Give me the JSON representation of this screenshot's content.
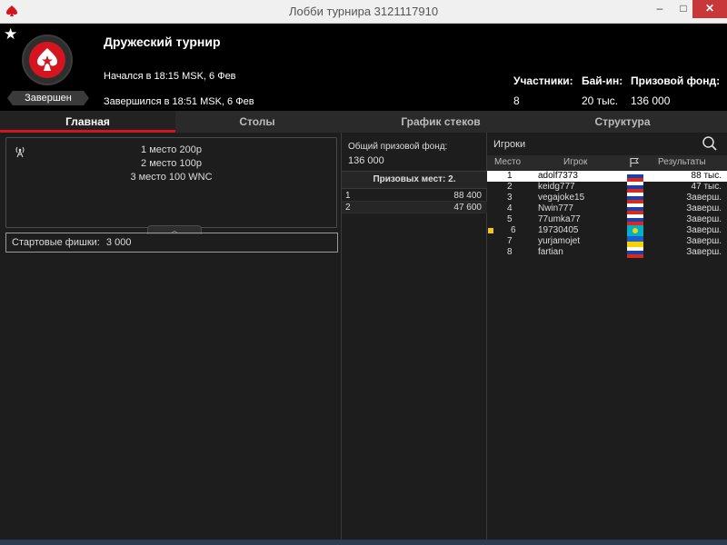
{
  "window": {
    "title": "Лобби турнира 3121117910",
    "min": "–",
    "max": "□",
    "close": "✕"
  },
  "header": {
    "tournament_name": "Дружеский турнир",
    "status": "Завершен",
    "started": "Начался в 18:15 MSK, 6 Фев",
    "ended": "Завершился в 18:51 MSK, 6 Фев",
    "stats": [
      {
        "label": "Участники:",
        "value": "8"
      },
      {
        "label": "Бай-ин:",
        "value": "20 тыс."
      },
      {
        "label": "Призовой фонд:",
        "value": "136 000"
      }
    ]
  },
  "tabs": [
    {
      "label": "Главная",
      "active": true
    },
    {
      "label": "Столы"
    },
    {
      "label": "График стеков"
    },
    {
      "label": "Структура"
    }
  ],
  "main": {
    "prize_lines": [
      "1 место 200р",
      "2 место 100р",
      "3 место 100 WNC"
    ],
    "starting_chips_label": "Стартовые фишки:",
    "starting_chips_value": "3 000"
  },
  "prize_pool": {
    "label": "Общий призовой фонд:",
    "value": "136 000",
    "paid_places_header": "Призовых мест: 2.",
    "payouts": [
      {
        "place": "1",
        "amount": "88 400"
      },
      {
        "place": "2",
        "amount": "47 600"
      }
    ]
  },
  "players": {
    "title": "Игроки",
    "columns": {
      "place": "Место",
      "player": "Игрок",
      "results": "Результаты"
    },
    "rows": [
      {
        "place": "1",
        "name": "adolf7373",
        "flag": "ru",
        "result": "88 тыс.",
        "selected": true
      },
      {
        "place": "2",
        "name": "keidg777",
        "flag": "ru",
        "result": "47 тыс."
      },
      {
        "place": "3",
        "name": "vegajoke15",
        "flag": "ru",
        "result": "Заверш."
      },
      {
        "place": "4",
        "name": "Nwin777",
        "flag": "ru",
        "result": "Заверш."
      },
      {
        "place": "5",
        "name": "77umka77",
        "flag": "ru",
        "result": "Заверш."
      },
      {
        "place": "6",
        "name": "19730405",
        "flag": "kz",
        "result": "Заверш.",
        "marked": true
      },
      {
        "place": "7",
        "name": "yurjamojet",
        "flag": "ua",
        "result": "Заверш."
      },
      {
        "place": "8",
        "name": "fartian",
        "flag": "ru",
        "result": "Заверш."
      }
    ]
  },
  "colors": {
    "accent": "#d4141f",
    "background": "#1d1d1d",
    "marker": "#f5c518"
  }
}
